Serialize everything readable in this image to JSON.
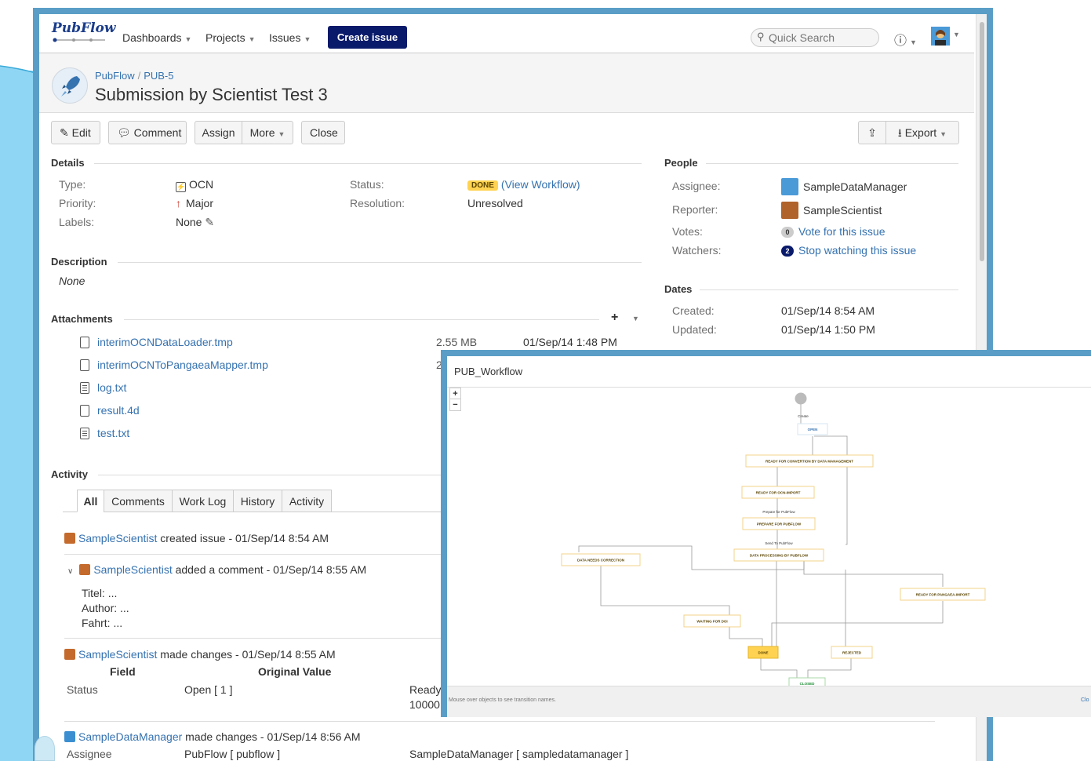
{
  "topbar": {
    "logo": "PubFlow",
    "nav": [
      "Dashboards",
      "Projects",
      "Issues"
    ],
    "create_label": "Create issue",
    "search_placeholder": "Quick Search"
  },
  "issue": {
    "breadcrumb_project": "PubFlow",
    "breadcrumb_key": "PUB-5",
    "summary": "Submission by Scientist Test 3"
  },
  "toolbar": {
    "edit": "Edit",
    "comment": "Comment",
    "assign": "Assign",
    "more": "More",
    "close": "Close",
    "export": "Export"
  },
  "details": {
    "title": "Details",
    "type_label": "Type:",
    "type_value": "OCN",
    "priority_label": "Priority:",
    "priority_value": "Major",
    "labels_label": "Labels:",
    "labels_value": "None",
    "status_label": "Status:",
    "status_value": "DONE",
    "view_workflow": "(View Workflow)",
    "resolution_label": "Resolution:",
    "resolution_value": "Unresolved"
  },
  "description": {
    "title": "Description",
    "value": "None"
  },
  "attachments": {
    "title": "Attachments",
    "files": [
      {
        "name": "interimOCNDataLoader.tmp",
        "kind": "file",
        "size": "2.55 MB",
        "date": "01/Sep/14 1:48 PM"
      },
      {
        "name": "interimOCNToPangaeaMapper.tmp",
        "kind": "file",
        "size": "2",
        "date": ""
      },
      {
        "name": "log.txt",
        "kind": "text",
        "size": "",
        "date": ""
      },
      {
        "name": "result.4d",
        "kind": "file",
        "size": "",
        "date": ""
      },
      {
        "name": "test.txt",
        "kind": "text",
        "size": "",
        "date": ""
      }
    ]
  },
  "people": {
    "title": "People",
    "assignee_label": "Assignee:",
    "assignee": "SampleDataManager",
    "reporter_label": "Reporter:",
    "reporter": "SampleScientist",
    "votes_label": "Votes:",
    "votes_count": "0",
    "votes_link": "Vote for this issue",
    "watchers_label": "Watchers:",
    "watchers_count": "2",
    "watchers_link": "Stop watching this issue"
  },
  "dates": {
    "title": "Dates",
    "created_label": "Created:",
    "created": "01/Sep/14 8:54 AM",
    "updated_label": "Updated:",
    "updated": "01/Sep/14 1:50 PM"
  },
  "activity": {
    "title": "Activity",
    "tabs": [
      "All",
      "Comments",
      "Work Log",
      "History",
      "Activity"
    ],
    "entries": {
      "e1_user": "SampleScientist",
      "e1_text": " created issue - 01/Sep/14 8:54 AM",
      "e2_user": "SampleScientist",
      "e2_text": " added a comment - 01/Sep/14 8:55 AM",
      "e2_body": [
        "Titel: ...",
        "Author: ...",
        "Fahrt: ..."
      ],
      "e3_user": "SampleScientist",
      "e3_text": " made changes - 01/Sep/14 8:55 AM",
      "e3_col_field": "Field",
      "e3_col_orig": "Original Value",
      "e3_field": "Status",
      "e3_orig": "Open [ 1 ]",
      "e3_new_1": "Ready",
      "e3_new_2": "10000",
      "e4_user": "SampleDataManager",
      "e4_text": " made changes - 01/Sep/14 8:56 AM",
      "e4_field": "Assignee",
      "e4_orig": "PubFlow [ pubflow ]",
      "e4_new": "SampleDataManager [ sampledatamanager ]"
    }
  },
  "workflow": {
    "title": "PUB_Workflow",
    "hint": "Mouse over objects to see transition names.",
    "close": "Clo",
    "create_label": "Create",
    "states": {
      "open": "OPEN",
      "rfc": "READY FOR CONVERTION BY DATA MANAGEMENT",
      "rfo": "READY FOR OCN-IMPORT",
      "prep": "PREPARE FOR PUBFLOW",
      "dp": "DATA PROCESSING BY PUBFLOW",
      "dnc": "DATA NEEDS CORRECTION",
      "rfp": "READY FOR PANGAEA-IMPORT",
      "wfd": "WAITING FOR DOI",
      "done": "DONE",
      "rejected": "REJECTED",
      "closed": "CLOSED"
    },
    "transitions": {
      "prepare": "Prepare for PubFlow",
      "send": "Send To PubFlow"
    }
  },
  "colors": {
    "frame": "#5a9ec7",
    "link": "#3572b0",
    "create_button": "#0a1a6b",
    "done_lozenge": "#ffd351"
  }
}
